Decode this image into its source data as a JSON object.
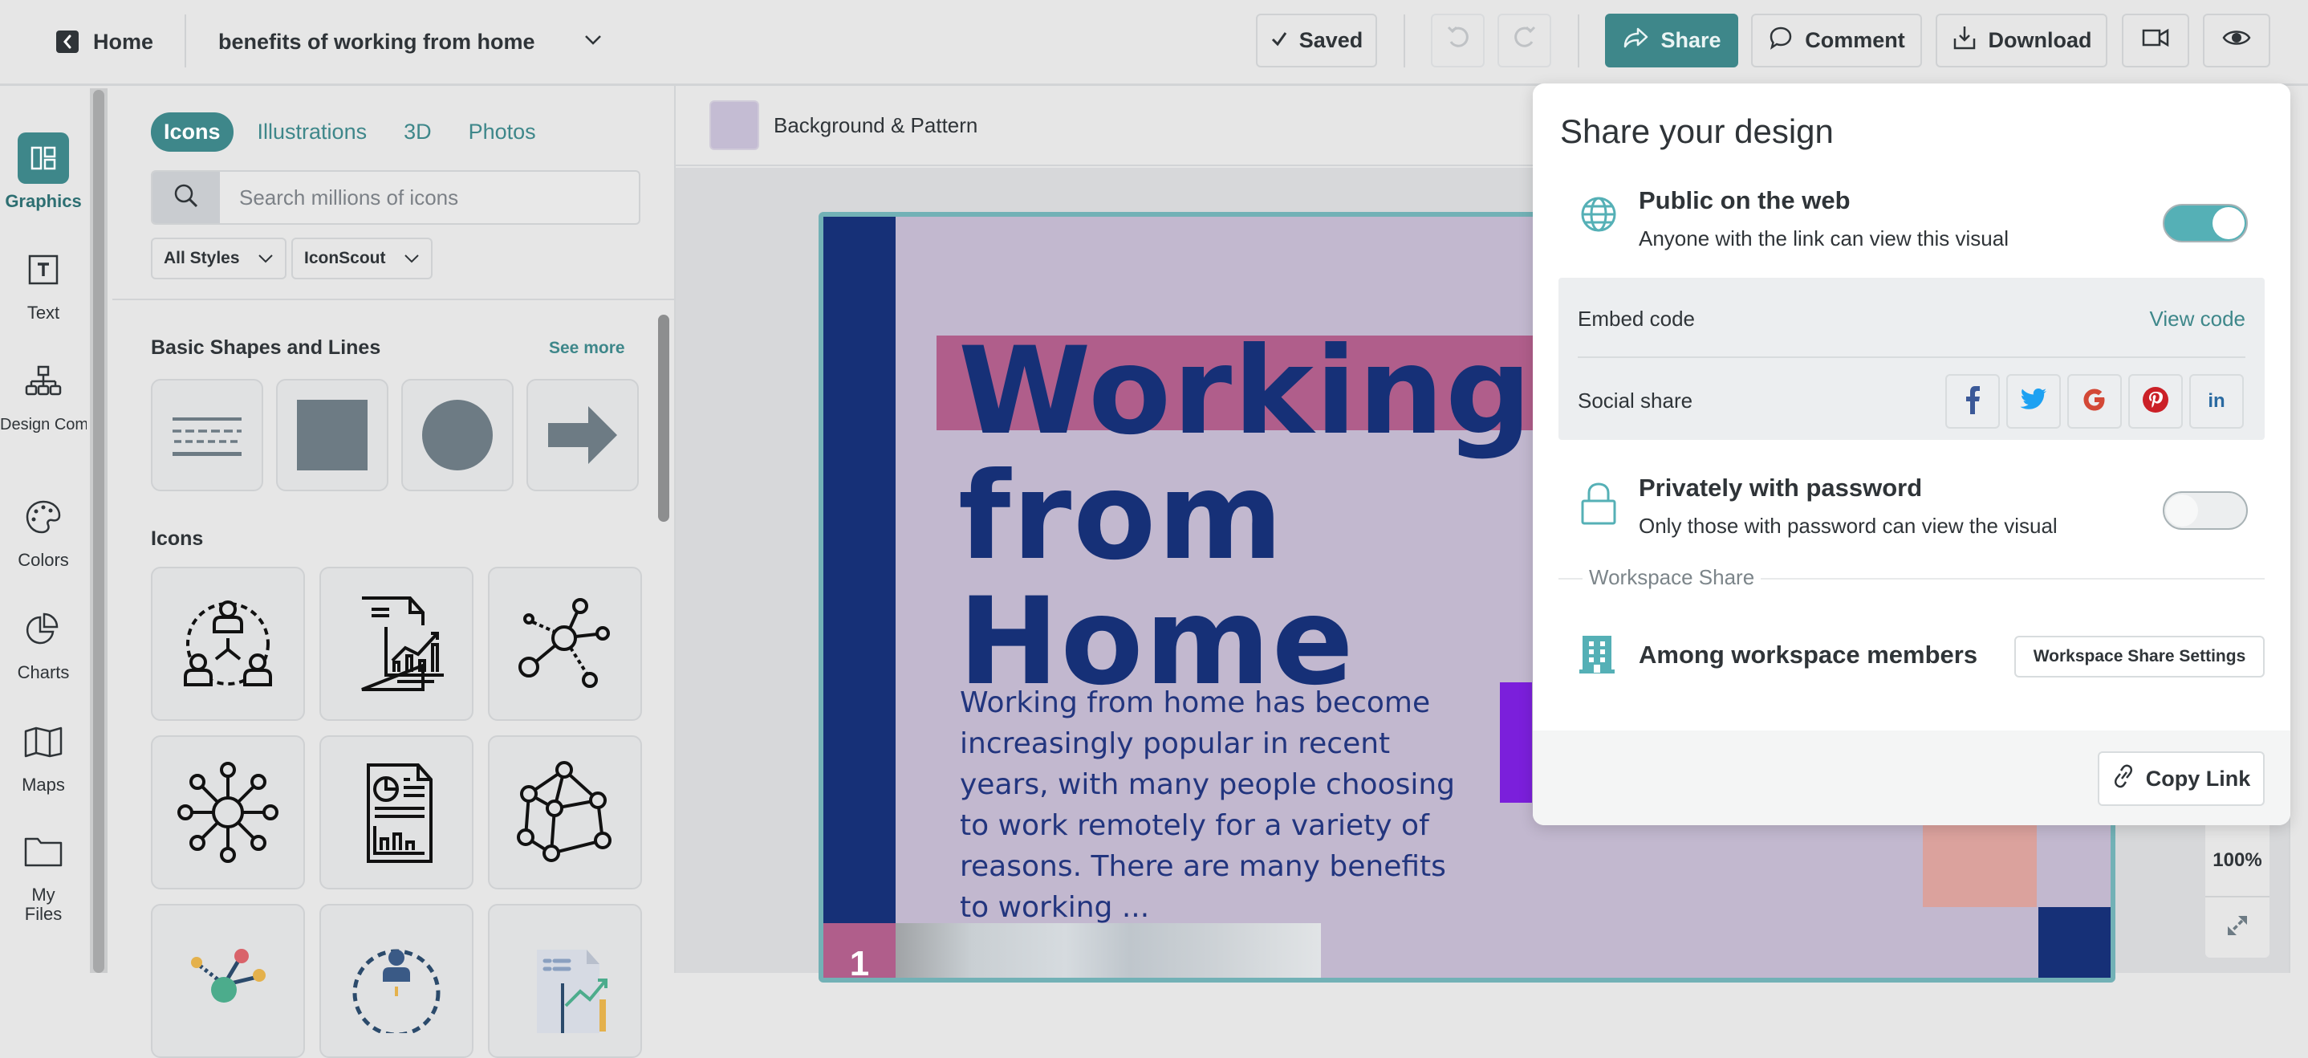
{
  "topbar": {
    "home_label": "Home",
    "doc_title": "benefits of working from home",
    "saved_label": "Saved",
    "share_label": "Share",
    "comment_label": "Comment",
    "download_label": "Download",
    "accent_color": "#3e878a"
  },
  "rail": {
    "items": [
      {
        "label": "Graphics",
        "icon": "graphics-icon",
        "active": true
      },
      {
        "label": "Text",
        "icon": "text-icon"
      },
      {
        "label": "Design Components",
        "icon": "design-components-icon"
      },
      {
        "label": "Colors",
        "icon": "palette-icon"
      },
      {
        "label": "Charts",
        "icon": "pie-chart-icon"
      },
      {
        "label": "Maps",
        "icon": "map-icon"
      },
      {
        "label": "My Files",
        "icon": "folder-icon"
      }
    ]
  },
  "panel": {
    "tabs": [
      "Icons",
      "Illustrations",
      "3D",
      "Photos"
    ],
    "active_tab": "Icons",
    "search_placeholder": "Search millions of icons",
    "search_value": "",
    "filters": [
      "All Styles",
      "IconScout"
    ],
    "shapes_section": "Basic Shapes and Lines",
    "see_more": "See more",
    "shapes": [
      "lines",
      "square",
      "circle",
      "arrow"
    ],
    "icons_section": "Icons",
    "icons": [
      "team-network-icon",
      "report-chart-icon",
      "node-network-icon",
      "hub-network-icon",
      "document-report-icon",
      "mesh-network-icon",
      "color-network-icon",
      "color-team-icon",
      "color-report-icon"
    ]
  },
  "canvas": {
    "background_label": "Background & Pattern",
    "slide": {
      "title_lines": [
        "Working",
        "from",
        "Home"
      ],
      "body": "Working from home has become increasingly popular in recent years, with many people choosing to work remotely for a variety of reasons. There are many benefits to working ...",
      "page_number": "1"
    },
    "zoom_level": "100%"
  },
  "share": {
    "title": "Share your design",
    "public": {
      "title": "Public on the web",
      "subtitle": "Anyone with the link can view this visual",
      "enabled": true
    },
    "embed_label": "Embed code",
    "view_code": "View code",
    "social_label": "Social share",
    "social": [
      "facebook",
      "twitter",
      "google",
      "pinterest",
      "linkedin"
    ],
    "private": {
      "title": "Privately with password",
      "subtitle": "Only those with password can view the visual",
      "enabled": false
    },
    "workspace_label": "Workspace Share",
    "workspace_title": "Among workspace members",
    "workspace_button": "Workspace Share Settings",
    "copy_link": "Copy Link"
  }
}
